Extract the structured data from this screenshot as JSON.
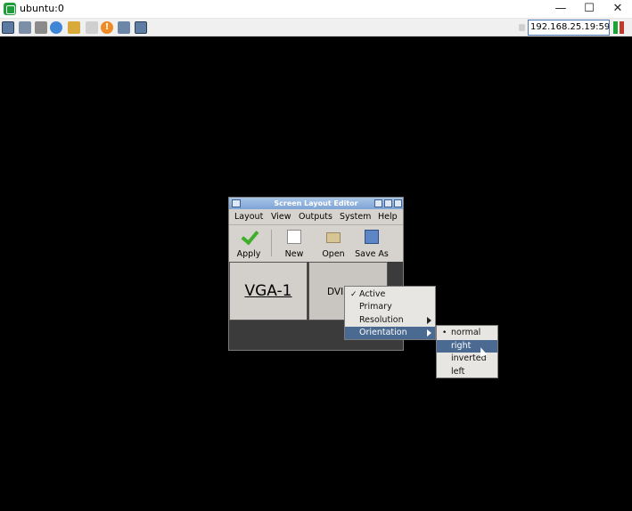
{
  "window": {
    "title": "ubuntu:0",
    "minimize_glyph": "—",
    "maximize_glyph": "☐",
    "close_glyph": "✕"
  },
  "toolbar": {
    "address": "192.168.25.19:5900",
    "alert_glyph": "!",
    "icons": [
      "options-icon",
      "connection-info-icon",
      "tools-icon",
      "refresh-icon",
      "ctrl-alt-del-icon",
      "keyboard-icon",
      "alert-icon",
      "transfer-icon",
      "fullscreen-icon"
    ]
  },
  "dialog": {
    "title": "Screen Layout Editor",
    "menus": [
      "Layout",
      "View",
      "Outputs",
      "System",
      "Help"
    ],
    "tools": [
      "Apply",
      "New",
      "Open",
      "Save As"
    ],
    "outputs": [
      "VGA-1",
      "DVI"
    ]
  },
  "context_menu": {
    "items": [
      {
        "label": "Active",
        "mark": "✓",
        "submenu": false,
        "selected": false
      },
      {
        "label": "Primary",
        "mark": "",
        "submenu": false,
        "selected": false
      },
      {
        "label": "Resolution",
        "mark": "",
        "submenu": true,
        "selected": false
      },
      {
        "label": "Orientation",
        "mark": "",
        "submenu": true,
        "selected": true
      }
    ]
  },
  "orientation_menu": {
    "items": [
      {
        "label": "normal",
        "mark": "•",
        "selected": false
      },
      {
        "label": "right",
        "mark": "",
        "selected": true
      },
      {
        "label": "inverted",
        "mark": "",
        "selected": false
      },
      {
        "label": "left",
        "mark": "",
        "selected": false
      }
    ]
  },
  "colors": {
    "selection": "#4b6a91",
    "desktop": "#000000",
    "titlebar_gradient_top": "#a8c4e6",
    "apply_check": "#3fae2a"
  }
}
